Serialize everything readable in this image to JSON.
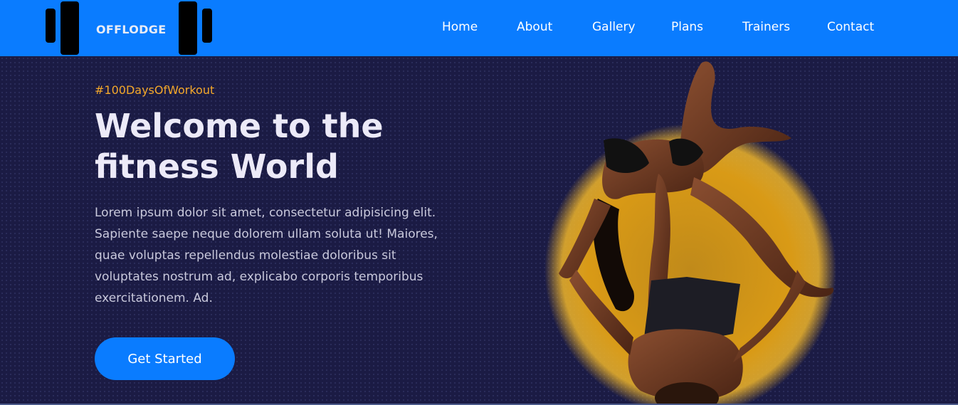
{
  "brand": {
    "name": "OFFLODGE",
    "logo_icon": "dumbbell-icon"
  },
  "nav": {
    "items": [
      {
        "label": "Home"
      },
      {
        "label": "About"
      },
      {
        "label": "Gallery"
      },
      {
        "label": "Plans"
      },
      {
        "label": "Trainers"
      },
      {
        "label": "Contact"
      }
    ]
  },
  "hero": {
    "hashtag": "#100DaysOfWorkout",
    "headline_line1": "Welcome to the",
    "headline_line2": "fitness World",
    "paragraph": "Lorem ipsum dolor sit amet, consectetur adipisicing elit. Sapiente saepe neque dolorem ullam soluta ut! Maiores, quae voluptas repellendus molestiae doloribus sit voluptates nostrum ad, explicabo corporis temporibus exercitationem. Ad.",
    "cta_label": "Get Started",
    "image_subject": "acrobatic-fitness-duo"
  },
  "colors": {
    "primary": "#0a7cff",
    "background": "#1b1b44",
    "accent": "#f4a82a",
    "text_light": "#eceaf8",
    "glow": "#e8a317"
  }
}
